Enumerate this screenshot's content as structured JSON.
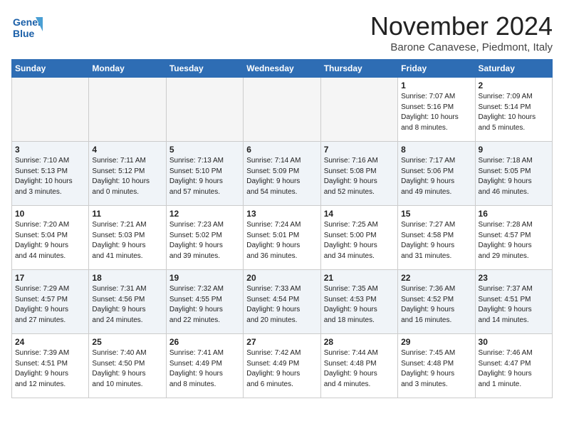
{
  "logo": {
    "line1": "General",
    "line2": "Blue"
  },
  "title": "November 2024",
  "location": "Barone Canavese, Piedmont, Italy",
  "weekdays": [
    "Sunday",
    "Monday",
    "Tuesday",
    "Wednesday",
    "Thursday",
    "Friday",
    "Saturday"
  ],
  "weeks": [
    [
      {
        "day": "",
        "info": ""
      },
      {
        "day": "",
        "info": ""
      },
      {
        "day": "",
        "info": ""
      },
      {
        "day": "",
        "info": ""
      },
      {
        "day": "",
        "info": ""
      },
      {
        "day": "1",
        "info": "Sunrise: 7:07 AM\nSunset: 5:16 PM\nDaylight: 10 hours\nand 8 minutes."
      },
      {
        "day": "2",
        "info": "Sunrise: 7:09 AM\nSunset: 5:14 PM\nDaylight: 10 hours\nand 5 minutes."
      }
    ],
    [
      {
        "day": "3",
        "info": "Sunrise: 7:10 AM\nSunset: 5:13 PM\nDaylight: 10 hours\nand 3 minutes."
      },
      {
        "day": "4",
        "info": "Sunrise: 7:11 AM\nSunset: 5:12 PM\nDaylight: 10 hours\nand 0 minutes."
      },
      {
        "day": "5",
        "info": "Sunrise: 7:13 AM\nSunset: 5:10 PM\nDaylight: 9 hours\nand 57 minutes."
      },
      {
        "day": "6",
        "info": "Sunrise: 7:14 AM\nSunset: 5:09 PM\nDaylight: 9 hours\nand 54 minutes."
      },
      {
        "day": "7",
        "info": "Sunrise: 7:16 AM\nSunset: 5:08 PM\nDaylight: 9 hours\nand 52 minutes."
      },
      {
        "day": "8",
        "info": "Sunrise: 7:17 AM\nSunset: 5:06 PM\nDaylight: 9 hours\nand 49 minutes."
      },
      {
        "day": "9",
        "info": "Sunrise: 7:18 AM\nSunset: 5:05 PM\nDaylight: 9 hours\nand 46 minutes."
      }
    ],
    [
      {
        "day": "10",
        "info": "Sunrise: 7:20 AM\nSunset: 5:04 PM\nDaylight: 9 hours\nand 44 minutes."
      },
      {
        "day": "11",
        "info": "Sunrise: 7:21 AM\nSunset: 5:03 PM\nDaylight: 9 hours\nand 41 minutes."
      },
      {
        "day": "12",
        "info": "Sunrise: 7:23 AM\nSunset: 5:02 PM\nDaylight: 9 hours\nand 39 minutes."
      },
      {
        "day": "13",
        "info": "Sunrise: 7:24 AM\nSunset: 5:01 PM\nDaylight: 9 hours\nand 36 minutes."
      },
      {
        "day": "14",
        "info": "Sunrise: 7:25 AM\nSunset: 5:00 PM\nDaylight: 9 hours\nand 34 minutes."
      },
      {
        "day": "15",
        "info": "Sunrise: 7:27 AM\nSunset: 4:58 PM\nDaylight: 9 hours\nand 31 minutes."
      },
      {
        "day": "16",
        "info": "Sunrise: 7:28 AM\nSunset: 4:57 PM\nDaylight: 9 hours\nand 29 minutes."
      }
    ],
    [
      {
        "day": "17",
        "info": "Sunrise: 7:29 AM\nSunset: 4:57 PM\nDaylight: 9 hours\nand 27 minutes."
      },
      {
        "day": "18",
        "info": "Sunrise: 7:31 AM\nSunset: 4:56 PM\nDaylight: 9 hours\nand 24 minutes."
      },
      {
        "day": "19",
        "info": "Sunrise: 7:32 AM\nSunset: 4:55 PM\nDaylight: 9 hours\nand 22 minutes."
      },
      {
        "day": "20",
        "info": "Sunrise: 7:33 AM\nSunset: 4:54 PM\nDaylight: 9 hours\nand 20 minutes."
      },
      {
        "day": "21",
        "info": "Sunrise: 7:35 AM\nSunset: 4:53 PM\nDaylight: 9 hours\nand 18 minutes."
      },
      {
        "day": "22",
        "info": "Sunrise: 7:36 AM\nSunset: 4:52 PM\nDaylight: 9 hours\nand 16 minutes."
      },
      {
        "day": "23",
        "info": "Sunrise: 7:37 AM\nSunset: 4:51 PM\nDaylight: 9 hours\nand 14 minutes."
      }
    ],
    [
      {
        "day": "24",
        "info": "Sunrise: 7:39 AM\nSunset: 4:51 PM\nDaylight: 9 hours\nand 12 minutes."
      },
      {
        "day": "25",
        "info": "Sunrise: 7:40 AM\nSunset: 4:50 PM\nDaylight: 9 hours\nand 10 minutes."
      },
      {
        "day": "26",
        "info": "Sunrise: 7:41 AM\nSunset: 4:49 PM\nDaylight: 9 hours\nand 8 minutes."
      },
      {
        "day": "27",
        "info": "Sunrise: 7:42 AM\nSunset: 4:49 PM\nDaylight: 9 hours\nand 6 minutes."
      },
      {
        "day": "28",
        "info": "Sunrise: 7:44 AM\nSunset: 4:48 PM\nDaylight: 9 hours\nand 4 minutes."
      },
      {
        "day": "29",
        "info": "Sunrise: 7:45 AM\nSunset: 4:48 PM\nDaylight: 9 hours\nand 3 minutes."
      },
      {
        "day": "30",
        "info": "Sunrise: 7:46 AM\nSunset: 4:47 PM\nDaylight: 9 hours\nand 1 minute."
      }
    ]
  ]
}
